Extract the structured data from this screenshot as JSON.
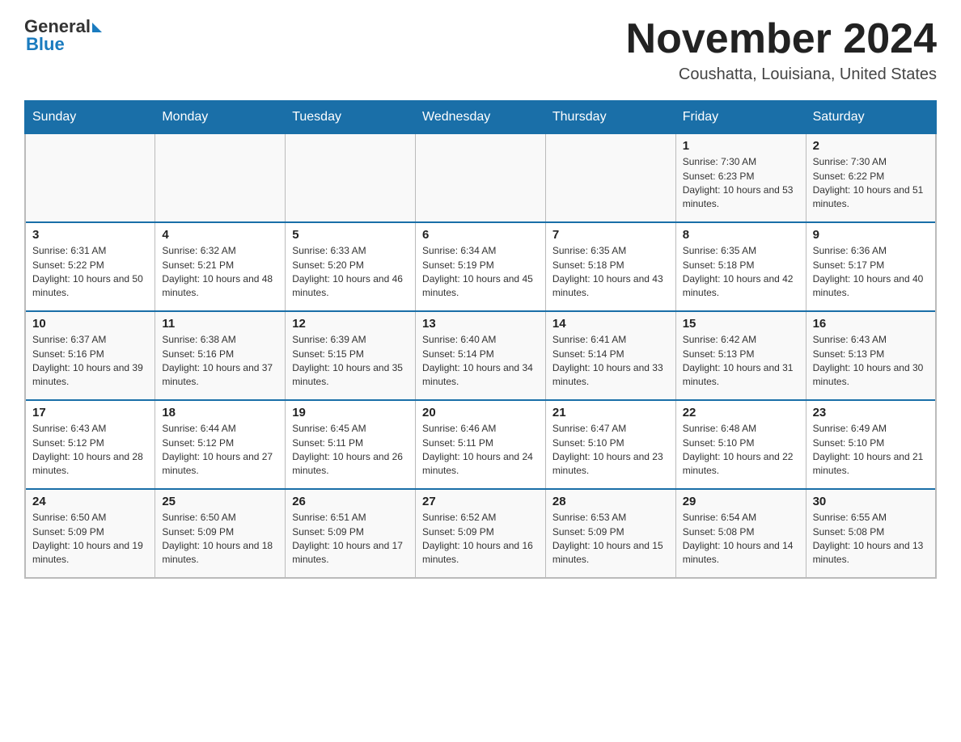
{
  "header": {
    "logo_text_general": "General",
    "logo_text_blue": "Blue",
    "main_title": "November 2024",
    "subtitle": "Coushatta, Louisiana, United States"
  },
  "days_of_week": [
    "Sunday",
    "Monday",
    "Tuesday",
    "Wednesday",
    "Thursday",
    "Friday",
    "Saturday"
  ],
  "weeks": [
    {
      "days": [
        {
          "num": "",
          "info": ""
        },
        {
          "num": "",
          "info": ""
        },
        {
          "num": "",
          "info": ""
        },
        {
          "num": "",
          "info": ""
        },
        {
          "num": "",
          "info": ""
        },
        {
          "num": "1",
          "info": "Sunrise: 7:30 AM\nSunset: 6:23 PM\nDaylight: 10 hours and 53 minutes."
        },
        {
          "num": "2",
          "info": "Sunrise: 7:30 AM\nSunset: 6:22 PM\nDaylight: 10 hours and 51 minutes."
        }
      ]
    },
    {
      "days": [
        {
          "num": "3",
          "info": "Sunrise: 6:31 AM\nSunset: 5:22 PM\nDaylight: 10 hours and 50 minutes."
        },
        {
          "num": "4",
          "info": "Sunrise: 6:32 AM\nSunset: 5:21 PM\nDaylight: 10 hours and 48 minutes."
        },
        {
          "num": "5",
          "info": "Sunrise: 6:33 AM\nSunset: 5:20 PM\nDaylight: 10 hours and 46 minutes."
        },
        {
          "num": "6",
          "info": "Sunrise: 6:34 AM\nSunset: 5:19 PM\nDaylight: 10 hours and 45 minutes."
        },
        {
          "num": "7",
          "info": "Sunrise: 6:35 AM\nSunset: 5:18 PM\nDaylight: 10 hours and 43 minutes."
        },
        {
          "num": "8",
          "info": "Sunrise: 6:35 AM\nSunset: 5:18 PM\nDaylight: 10 hours and 42 minutes."
        },
        {
          "num": "9",
          "info": "Sunrise: 6:36 AM\nSunset: 5:17 PM\nDaylight: 10 hours and 40 minutes."
        }
      ]
    },
    {
      "days": [
        {
          "num": "10",
          "info": "Sunrise: 6:37 AM\nSunset: 5:16 PM\nDaylight: 10 hours and 39 minutes."
        },
        {
          "num": "11",
          "info": "Sunrise: 6:38 AM\nSunset: 5:16 PM\nDaylight: 10 hours and 37 minutes."
        },
        {
          "num": "12",
          "info": "Sunrise: 6:39 AM\nSunset: 5:15 PM\nDaylight: 10 hours and 35 minutes."
        },
        {
          "num": "13",
          "info": "Sunrise: 6:40 AM\nSunset: 5:14 PM\nDaylight: 10 hours and 34 minutes."
        },
        {
          "num": "14",
          "info": "Sunrise: 6:41 AM\nSunset: 5:14 PM\nDaylight: 10 hours and 33 minutes."
        },
        {
          "num": "15",
          "info": "Sunrise: 6:42 AM\nSunset: 5:13 PM\nDaylight: 10 hours and 31 minutes."
        },
        {
          "num": "16",
          "info": "Sunrise: 6:43 AM\nSunset: 5:13 PM\nDaylight: 10 hours and 30 minutes."
        }
      ]
    },
    {
      "days": [
        {
          "num": "17",
          "info": "Sunrise: 6:43 AM\nSunset: 5:12 PM\nDaylight: 10 hours and 28 minutes."
        },
        {
          "num": "18",
          "info": "Sunrise: 6:44 AM\nSunset: 5:12 PM\nDaylight: 10 hours and 27 minutes."
        },
        {
          "num": "19",
          "info": "Sunrise: 6:45 AM\nSunset: 5:11 PM\nDaylight: 10 hours and 26 minutes."
        },
        {
          "num": "20",
          "info": "Sunrise: 6:46 AM\nSunset: 5:11 PM\nDaylight: 10 hours and 24 minutes."
        },
        {
          "num": "21",
          "info": "Sunrise: 6:47 AM\nSunset: 5:10 PM\nDaylight: 10 hours and 23 minutes."
        },
        {
          "num": "22",
          "info": "Sunrise: 6:48 AM\nSunset: 5:10 PM\nDaylight: 10 hours and 22 minutes."
        },
        {
          "num": "23",
          "info": "Sunrise: 6:49 AM\nSunset: 5:10 PM\nDaylight: 10 hours and 21 minutes."
        }
      ]
    },
    {
      "days": [
        {
          "num": "24",
          "info": "Sunrise: 6:50 AM\nSunset: 5:09 PM\nDaylight: 10 hours and 19 minutes."
        },
        {
          "num": "25",
          "info": "Sunrise: 6:50 AM\nSunset: 5:09 PM\nDaylight: 10 hours and 18 minutes."
        },
        {
          "num": "26",
          "info": "Sunrise: 6:51 AM\nSunset: 5:09 PM\nDaylight: 10 hours and 17 minutes."
        },
        {
          "num": "27",
          "info": "Sunrise: 6:52 AM\nSunset: 5:09 PM\nDaylight: 10 hours and 16 minutes."
        },
        {
          "num": "28",
          "info": "Sunrise: 6:53 AM\nSunset: 5:09 PM\nDaylight: 10 hours and 15 minutes."
        },
        {
          "num": "29",
          "info": "Sunrise: 6:54 AM\nSunset: 5:08 PM\nDaylight: 10 hours and 14 minutes."
        },
        {
          "num": "30",
          "info": "Sunrise: 6:55 AM\nSunset: 5:08 PM\nDaylight: 10 hours and 13 minutes."
        }
      ]
    }
  ]
}
